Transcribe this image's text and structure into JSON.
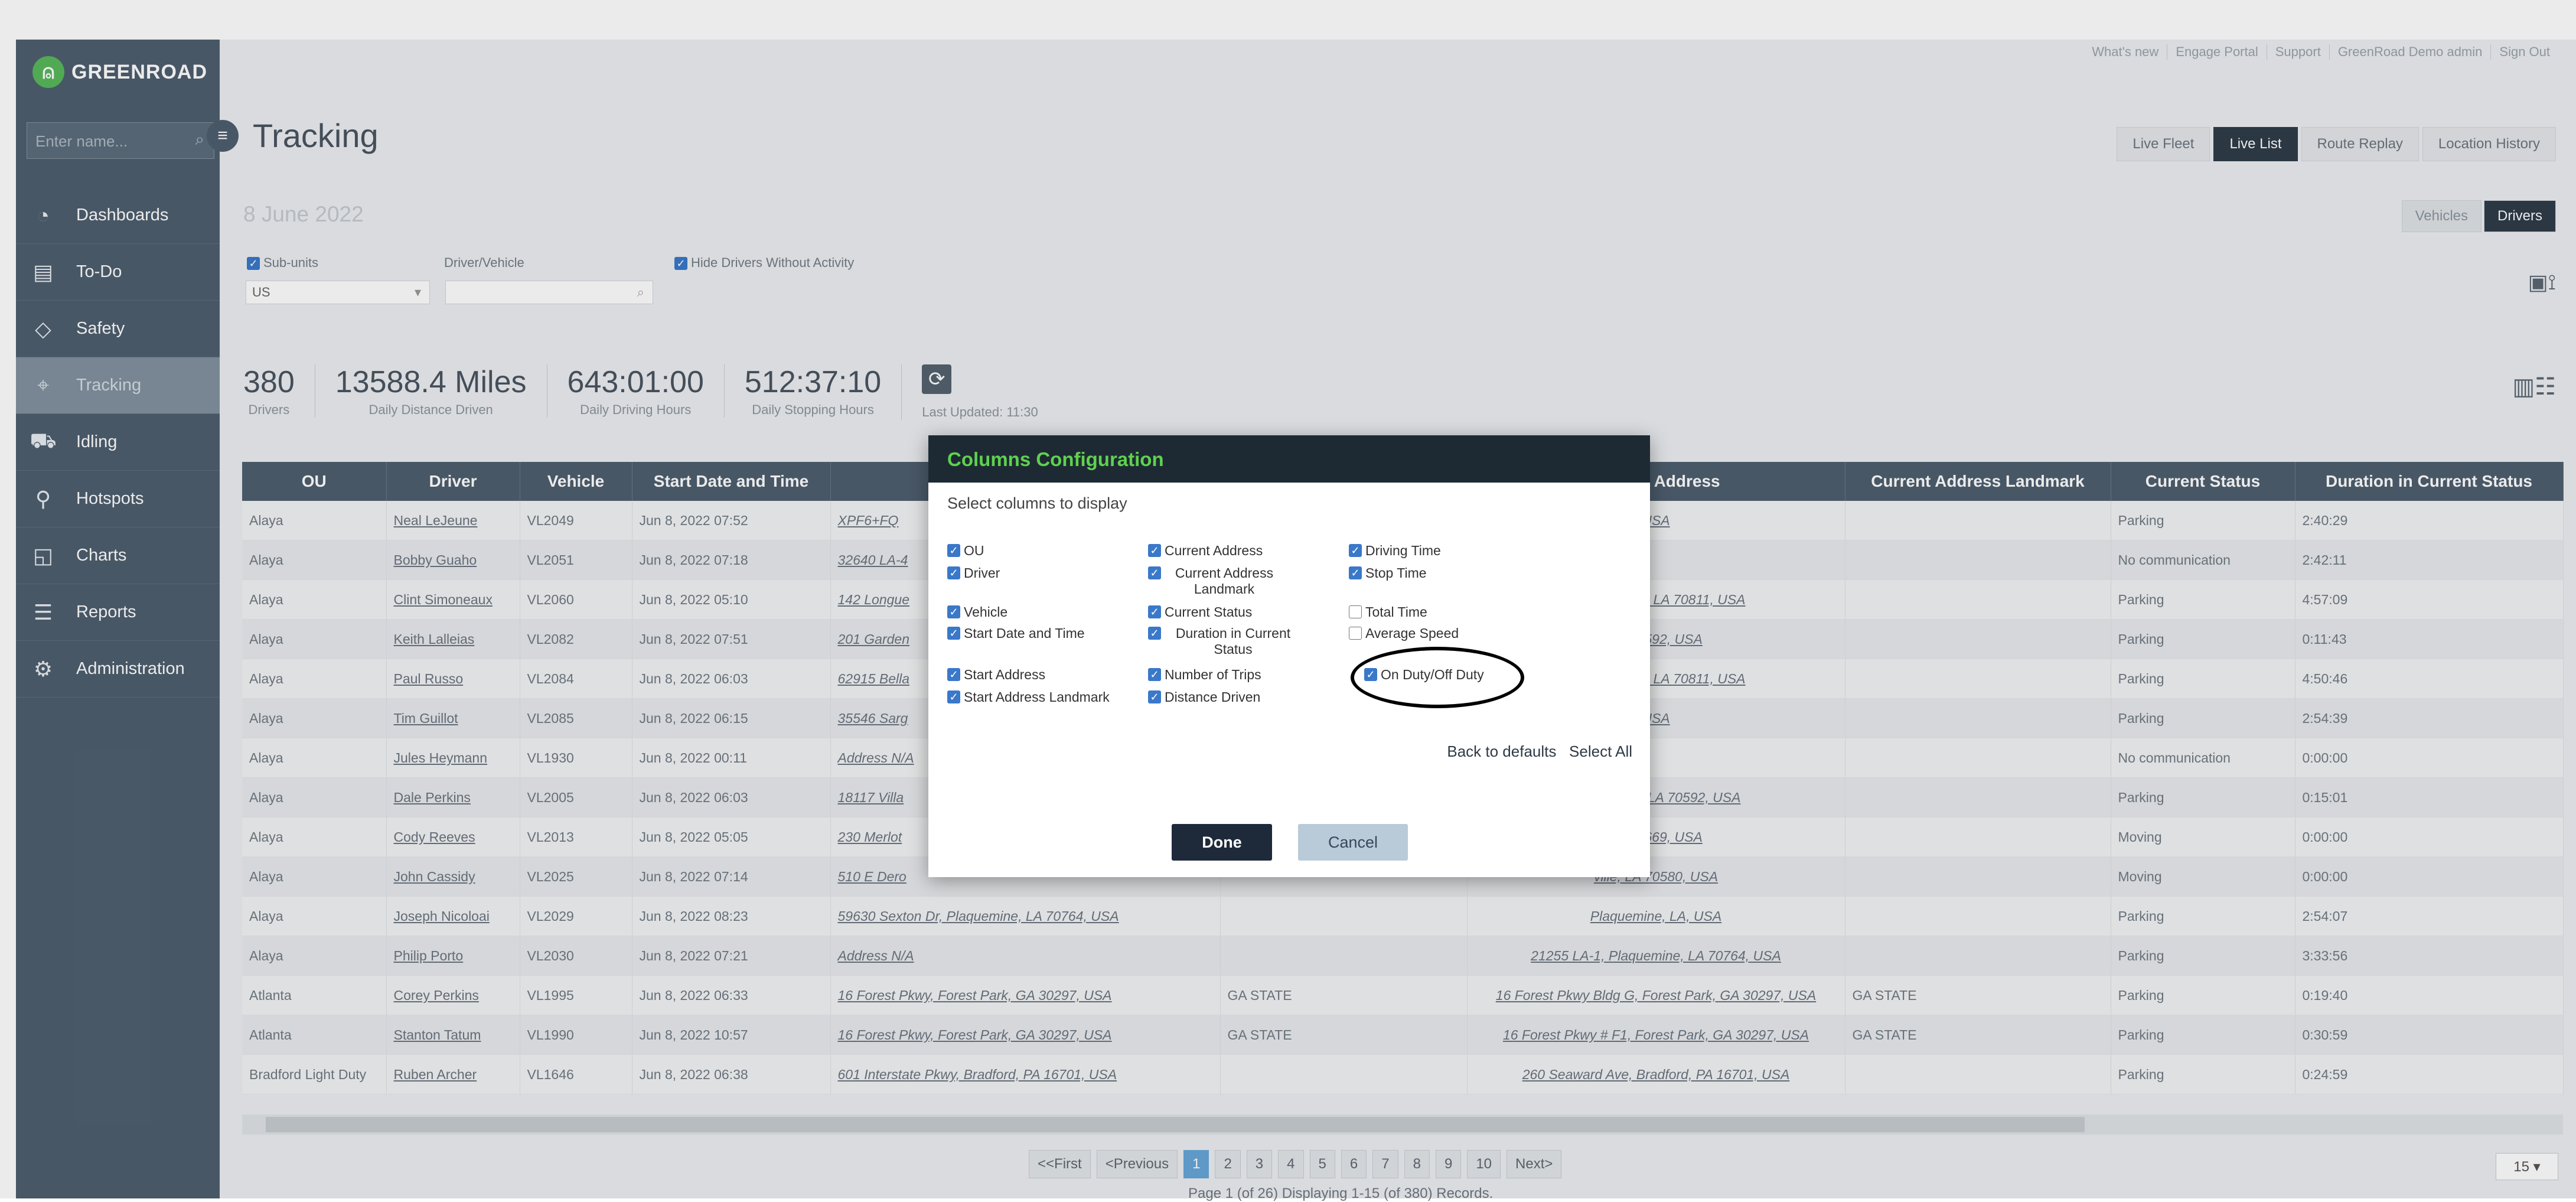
{
  "brand": {
    "logo_text": "GREENROAD"
  },
  "sidebar": {
    "search_placeholder": "Enter name...",
    "items": [
      {
        "label": "Dashboards",
        "icon": "gauge-icon"
      },
      {
        "label": "To-Do",
        "icon": "clipboard-icon"
      },
      {
        "label": "Safety",
        "icon": "diamond-icon"
      },
      {
        "label": "Tracking",
        "icon": "tracking-icon",
        "active": true
      },
      {
        "label": "Idling",
        "icon": "idling-icon"
      },
      {
        "label": "Hotspots",
        "icon": "hotspots-icon"
      },
      {
        "label": "Charts",
        "icon": "chart-icon"
      },
      {
        "label": "Reports",
        "icon": "reports-icon"
      },
      {
        "label": "Administration",
        "icon": "gear-icon"
      }
    ]
  },
  "header": {
    "links": [
      "What's new",
      "Engage Portal",
      "Support",
      "GreenRoad Demo admin",
      "Sign Out"
    ],
    "title": "Tracking",
    "view_tabs": [
      "Live Fleet",
      "Live List",
      "Route Replay",
      "Location History"
    ],
    "active_view_tab": "Live List"
  },
  "date": "8 June 2022",
  "toggle": {
    "vehicles": "Vehicles",
    "drivers": "Drivers",
    "active": "Drivers"
  },
  "filters": {
    "subunits_label": "Sub-units",
    "driver_vehicle_label": "Driver/Vehicle",
    "hide_label": "Hide Drivers Without Activity",
    "ou_value": "US"
  },
  "stats": [
    {
      "value": "380",
      "label": "Drivers"
    },
    {
      "value": "13588.4 Miles",
      "label": "Daily Distance Driven"
    },
    {
      "value": "643:01:00",
      "label": "Daily Driving Hours"
    },
    {
      "value": "512:37:10",
      "label": "Daily Stopping Hours"
    }
  ],
  "last_updated": "Last Updated: 11:30",
  "table": {
    "columns": [
      "OU",
      "Driver",
      "Vehicle",
      "Start Date and Time",
      "",
      "",
      "t Address",
      "Current Address Landmark",
      "Current Status",
      "Duration in Current Status"
    ],
    "rows": [
      [
        "Alaya",
        "Neal LeJeune",
        "VL2049",
        "Jun 8, 2022 07:52",
        "XPF6+FQ",
        "",
        "USA",
        "",
        "Parking",
        "2:40:29"
      ],
      [
        "Alaya",
        "Bobby Guaho",
        "VL2051",
        "Jun 8, 2022 07:18",
        "32640 LA-4",
        "",
        "",
        "",
        "No communication",
        "2:42:11"
      ],
      [
        "Alaya",
        "Clint Simoneaux",
        "VL2060",
        "Jun 8, 2022 05:10",
        "142 Longue",
        "",
        "Baton Rouge, LA 70811, USA",
        "",
        "Parking",
        "4:57:09"
      ],
      [
        "Alaya",
        "Keith Lalleias",
        "VL2082",
        "Jun 8, 2022 07:51",
        "201 Garden",
        "",
        "LA 70592, USA",
        "",
        "Parking",
        "0:11:43"
      ],
      [
        "Alaya",
        "Paul Russo",
        "VL2084",
        "Jun 8, 2022 06:03",
        "62915 Bella",
        "",
        "Baton Rouge, LA 70811, USA",
        "",
        "Parking",
        "4:50:46"
      ],
      [
        "Alaya",
        "Tim Guillot",
        "VL2085",
        "Jun 8, 2022 06:15",
        "35546 Sarg",
        "",
        "USA",
        "",
        "Parking",
        "2:54:39"
      ],
      [
        "Alaya",
        "Jules Heymann",
        "VL1930",
        "Jun 8, 2022 00:11",
        "Address N/A",
        "",
        "",
        "",
        "No communication",
        "0:00:00"
      ],
      [
        "Alaya",
        "Dale Perkins",
        "VL2005",
        "Jun 8, 2022 06:03",
        "18117 Villa",
        "",
        "Youngsville, LA 70592, USA",
        "",
        "Parking",
        "0:15:01"
      ],
      [
        "Alaya",
        "Cody Reeves",
        "VL2013",
        "Jun 8, 2022 05:05",
        "230 Merlot",
        "",
        "LA 70669, USA",
        "",
        "Moving",
        "0:00:00"
      ],
      [
        "Alaya",
        "John Cassidy",
        "VL2025",
        "Jun 8, 2022 07:14",
        "510 E Dero",
        "",
        "ville, LA 70580, USA",
        "",
        "Moving",
        "0:00:00"
      ],
      [
        "Alaya",
        "Joseph Nicoloai",
        "VL2029",
        "Jun 8, 2022 08:23",
        "59630 Sexton Dr, Plaquemine, LA 70764, USA",
        "",
        "Plaquemine, LA, USA",
        "",
        "Parking",
        "2:54:07"
      ],
      [
        "Alaya",
        "Philip Porto",
        "VL2030",
        "Jun 8, 2022 07:21",
        "Address N/A",
        "",
        "21255 LA-1, Plaquemine, LA 70764, USA",
        "",
        "Parking",
        "3:33:56"
      ],
      [
        "Atlanta",
        "Corey Perkins",
        "VL1995",
        "Jun 8, 2022 06:33",
        "16 Forest Pkwy, Forest Park, GA 30297, USA",
        "GA STATE",
        "16 Forest Pkwy Bldg G, Forest Park, GA 30297, USA",
        "GA STATE",
        "Parking",
        "0:19:40"
      ],
      [
        "Atlanta",
        "Stanton Tatum",
        "VL1990",
        "Jun 8, 2022 10:57",
        "16 Forest Pkwy, Forest Park, GA 30297, USA",
        "GA STATE",
        "16 Forest Pkwy # F1, Forest Park, GA 30297, USA",
        "GA STATE",
        "Parking",
        "0:30:59"
      ],
      [
        "Bradford Light Duty",
        "Ruben Archer",
        "VL1646",
        "Jun 8, 2022 06:38",
        "601 Interstate Pkwy, Bradford, PA 16701, USA",
        "",
        "260 Seaward Ave, Bradford, PA 16701, USA",
        "",
        "Parking",
        "0:24:59"
      ]
    ]
  },
  "pagination": {
    "first": "<<First",
    "previous": "<Previous",
    "pages": [
      "1",
      "2",
      "3",
      "4",
      "5",
      "6",
      "7",
      "8",
      "9",
      "10"
    ],
    "current": "1",
    "next": "Next>",
    "info": "Page 1 (of 26) Displaying 1-15 (of 380) Records.",
    "page_size": "15 ▾"
  },
  "modal": {
    "title": "Columns Configuration",
    "subtitle": "Select columns to display",
    "options": [
      {
        "label": "OU",
        "checked": true
      },
      {
        "label": "Driver",
        "checked": true
      },
      {
        "label": "Vehicle",
        "checked": true
      },
      {
        "label": "Start Date and Time",
        "checked": true
      },
      {
        "label": "Start Address",
        "checked": true
      },
      {
        "label": "Start Address Landmark",
        "checked": true
      },
      {
        "label": "Current Address",
        "checked": true
      },
      {
        "label": "Current Address Landmark",
        "checked": true
      },
      {
        "label": "Current Status",
        "checked": true
      },
      {
        "label": "Duration in Current Status",
        "checked": true
      },
      {
        "label": "Number of Trips",
        "checked": true
      },
      {
        "label": "Distance Driven",
        "checked": true
      },
      {
        "label": "Driving Time",
        "checked": true
      },
      {
        "label": "Stop Time",
        "checked": true
      },
      {
        "label": "Total Time",
        "checked": false
      },
      {
        "label": "Average Speed",
        "checked": false
      },
      {
        "label": "On Duty/Off Duty",
        "checked": true
      }
    ],
    "back_to_defaults": "Back to defaults",
    "select_all": "Select All",
    "done": "Done",
    "cancel": "Cancel"
  }
}
